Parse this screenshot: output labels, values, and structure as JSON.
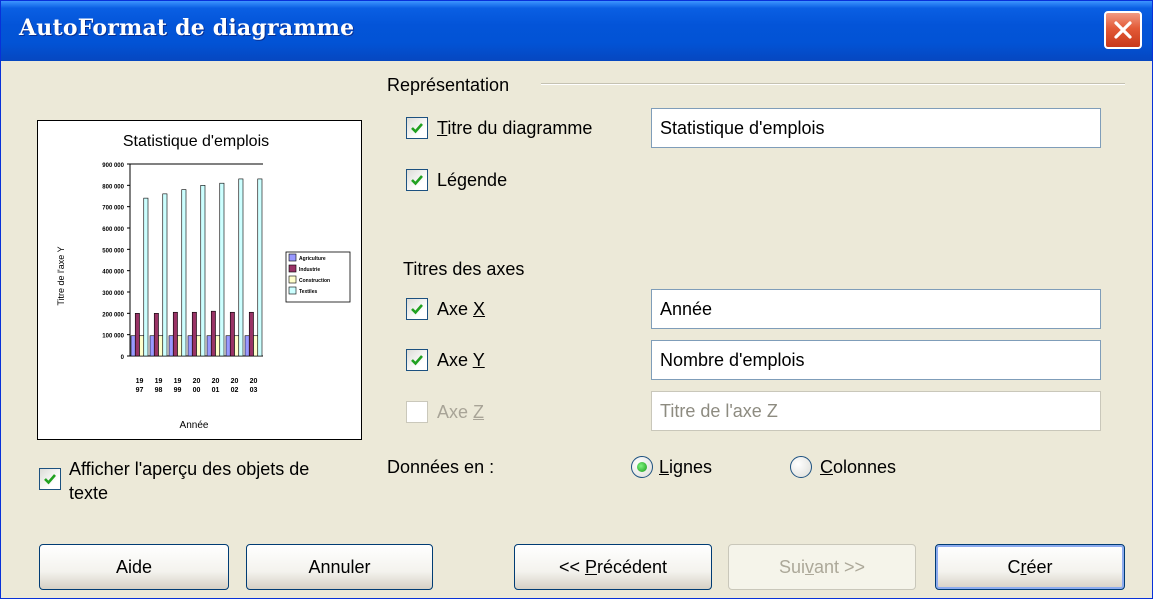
{
  "window": {
    "title": "AutoFormat de diagramme"
  },
  "preview": {
    "show_text_objects_label": "Afficher l'aperçu des objets de texte",
    "show_text_objects_checked": true,
    "chart_data": {
      "type": "bar",
      "title": "Statistique d'emplois",
      "xlabel": "Année",
      "ylabel": "Titre de l'axe Y",
      "ylim": [
        0,
        900000
      ],
      "yticks": [
        "900 000",
        "800 000",
        "700 000",
        "600 000",
        "500 000",
        "400 000",
        "300 000",
        "200 000",
        "100 000",
        "0"
      ],
      "categories": [
        "1997",
        "1998",
        "1999",
        "2000",
        "2001",
        "2002",
        "2003"
      ],
      "category_labels_top": [
        "19",
        "19",
        "19",
        "20",
        "20",
        "20",
        "20"
      ],
      "category_labels_bottom": [
        "97",
        "98",
        "99",
        "00",
        "01",
        "02",
        "03"
      ],
      "series": [
        {
          "name": "Agriculture",
          "color": "#9999ff",
          "values": [
            95000,
            95000,
            95000,
            95000,
            95000,
            95000,
            95000
          ]
        },
        {
          "name": "Industrie",
          "color": "#993366",
          "values": [
            200000,
            200000,
            205000,
            205000,
            210000,
            205000,
            205000
          ]
        },
        {
          "name": "Construction",
          "color": "#ffffcc",
          "values": [
            95000,
            95000,
            95000,
            95000,
            95000,
            95000,
            95000
          ]
        },
        {
          "name": "Textiles",
          "color": "#ccffff",
          "values": [
            740000,
            760000,
            780000,
            800000,
            810000,
            830000,
            830000
          ]
        }
      ]
    }
  },
  "representation": {
    "group_label": "Représentation",
    "chart_title": {
      "label_underlined": "T",
      "label_rest": "itre du diagramme",
      "checked": true,
      "value": "Statistique d'emplois"
    },
    "legend": {
      "label": "Légende",
      "checked": true
    }
  },
  "axes": {
    "group_label": "Titres des axes",
    "x": {
      "label_prefix": "Axe ",
      "label_underlined": "X",
      "checked": true,
      "value": "Année"
    },
    "y": {
      "label_prefix": "Axe ",
      "label_underlined": "Y",
      "checked": true,
      "value": "Nombre d'emplois"
    },
    "z": {
      "label_prefix": "Axe ",
      "label_underlined": "Z",
      "checked": false,
      "enabled": false,
      "placeholder": "Titre de l'axe Z"
    }
  },
  "data_in": {
    "label": "Données en :",
    "rows": {
      "label_underlined": "L",
      "label_rest": "ignes",
      "selected": true
    },
    "columns": {
      "label_underlined": "C",
      "label_rest": "olonnes",
      "selected": false
    }
  },
  "buttons": {
    "help": "Aide",
    "cancel": "Annuler",
    "previous_prefix": "<< ",
    "previous_underlined": "P",
    "previous_rest": "récédent",
    "next_prefix": "Sui",
    "next_underlined": "v",
    "next_rest": "ant >>",
    "create_prefix": "C",
    "create_underlined": "r",
    "create_rest": "éer"
  },
  "icons": {
    "close": "close-icon",
    "checkmark": "checkmark-icon"
  }
}
